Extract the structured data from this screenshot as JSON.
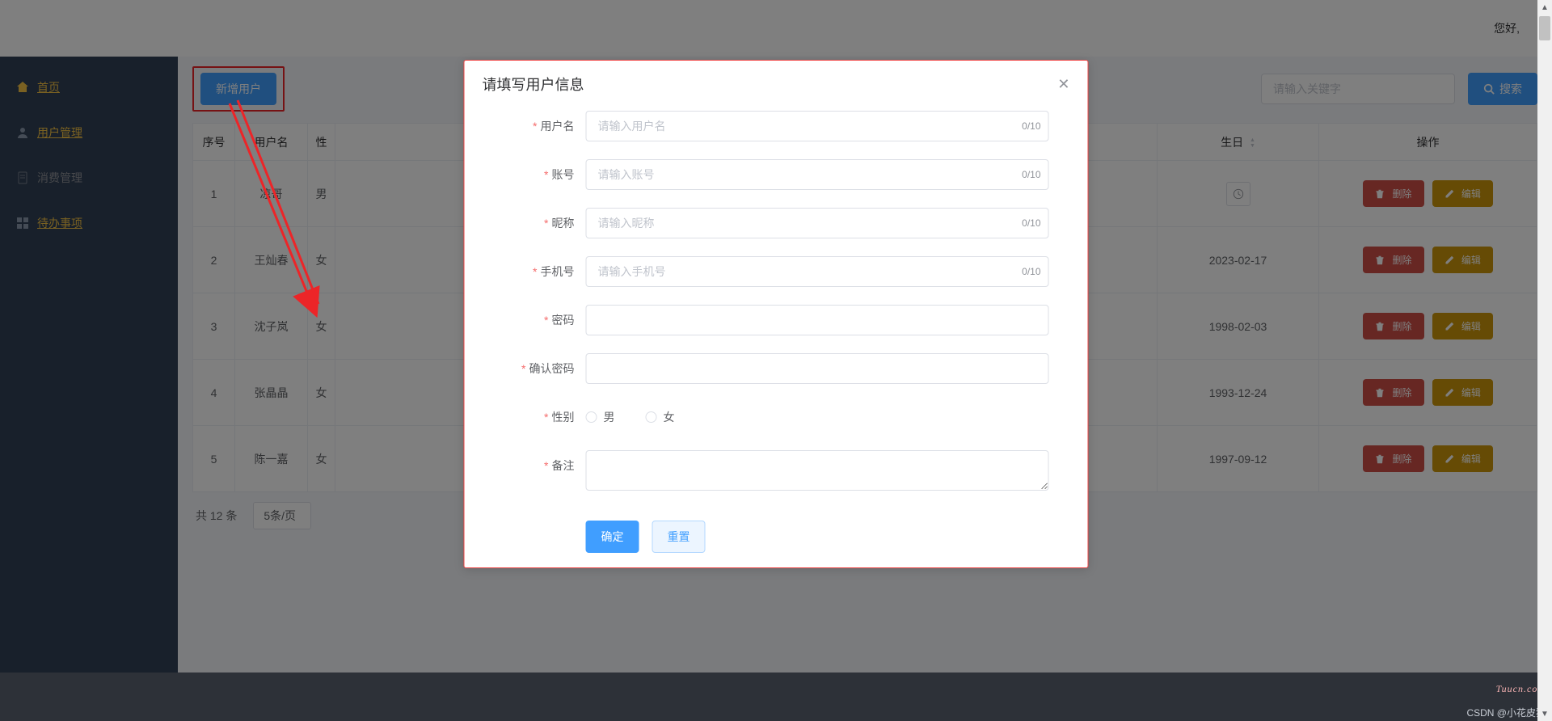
{
  "header": {
    "greeting": "您好,"
  },
  "sidebar": {
    "items": [
      {
        "label": "首页",
        "icon": "home-icon"
      },
      {
        "label": "用户管理",
        "icon": "user-icon"
      },
      {
        "label": "消费管理",
        "icon": "doc-icon"
      },
      {
        "label": "待办事项",
        "icon": "grid-icon"
      }
    ]
  },
  "toolbar": {
    "add_user_label": "新增用户",
    "search_placeholder": "请输入关键字",
    "search_button": "搜索"
  },
  "table": {
    "headers": {
      "index": "序号",
      "username": "用户名",
      "sex": "性",
      "birthday": "生日",
      "ops": "操作"
    },
    "rows": [
      {
        "idx": "1",
        "name": "凉哥",
        "sex": "男",
        "bday": "",
        "show_clock": true
      },
      {
        "idx": "2",
        "name": "王灿春",
        "sex": "女",
        "bday": "2023-02-17",
        "show_clock": false
      },
      {
        "idx": "3",
        "name": "沈子岚",
        "sex": "女",
        "bday": "1998-02-03",
        "show_clock": false
      },
      {
        "idx": "4",
        "name": "张晶晶",
        "sex": "女",
        "bday": "1993-12-24",
        "show_clock": false
      },
      {
        "idx": "5",
        "name": "陈一嘉",
        "sex": "女",
        "bday": "1997-09-12",
        "show_clock": false
      }
    ],
    "ops": {
      "delete": "删除",
      "edit": "编辑"
    }
  },
  "pager": {
    "total": "共 12 条",
    "size": "5条/页"
  },
  "modal": {
    "title": "请填写用户信息",
    "fields": {
      "username": {
        "label": "用户名",
        "placeholder": "请输入用户名",
        "count": "0/10"
      },
      "account": {
        "label": "账号",
        "placeholder": "请输入账号",
        "count": "0/10"
      },
      "nickname": {
        "label": "昵称",
        "placeholder": "请输入昵称",
        "count": "0/10"
      },
      "phone": {
        "label": "手机号",
        "placeholder": "请输入手机号",
        "count": "0/10"
      },
      "password": {
        "label": "密码"
      },
      "confirm": {
        "label": "确认密码"
      },
      "sex": {
        "label": "性别",
        "male": "男",
        "female": "女"
      },
      "remark": {
        "label": "备注"
      }
    },
    "buttons": {
      "confirm": "确定",
      "reset": "重置"
    }
  },
  "watermarks": {
    "w1": "Tuucn.com",
    "w2": "CSDN @小花皮猪"
  }
}
